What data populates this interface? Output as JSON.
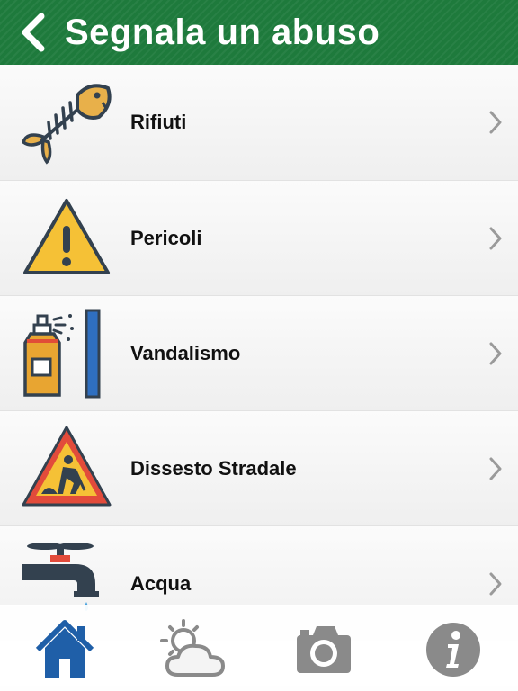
{
  "header": {
    "title": "Segnala un abuso",
    "back_icon": "chevron-left-icon",
    "background_color": "#1e7a3c"
  },
  "categories": [
    {
      "label": "Rifiuti",
      "icon": "fish-bone-icon"
    },
    {
      "label": "Pericoli",
      "icon": "warning-triangle-icon"
    },
    {
      "label": "Vandalismo",
      "icon": "spray-can-icon"
    },
    {
      "label": "Dissesto Stradale",
      "icon": "road-works-sign-icon"
    },
    {
      "label": "Acqua",
      "icon": "water-tap-icon"
    }
  ],
  "tabbar": {
    "items": [
      {
        "icon": "home-icon",
        "active": true
      },
      {
        "icon": "weather-icon",
        "active": false
      },
      {
        "icon": "camera-icon",
        "active": false
      },
      {
        "icon": "info-icon",
        "active": false
      }
    ],
    "active_color": "#1f5fa8",
    "inactive_color": "#8a8a8a"
  }
}
